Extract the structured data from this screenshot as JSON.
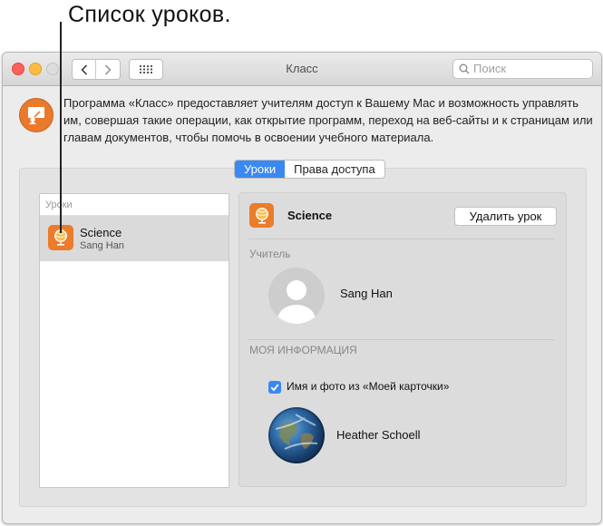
{
  "callout": {
    "text": "Список уроков."
  },
  "window": {
    "title": "Класс",
    "nav": {
      "back": "‹",
      "forward": "›"
    },
    "search_placeholder": "Поиск"
  },
  "description": "Программа «Класс» предоставляет учителям доступ к Вашему Mac и возможность управлять им, совершая такие операции, как открытие программ, переход на веб-сайты и к страницам или главам документов, чтобы помочь в освоении учебного материала.",
  "tabs": [
    {
      "label": "Уроки",
      "active": true
    },
    {
      "label": "Права доступа",
      "active": false
    }
  ],
  "lessons": {
    "header": "Уроки",
    "items": [
      {
        "name": "Science",
        "teacher": "Sang Han",
        "selected": true
      }
    ]
  },
  "details": {
    "title": "Science",
    "delete_label": "Удалить урок",
    "teacher_section": "Учитель",
    "teacher_name": "Sang Han",
    "my_info_section": "МОЯ ИНФОРМАЦИЯ",
    "checkbox_label": "Имя и фото из «Моей карточки»",
    "checkbox_checked": true,
    "student_name": "Heather Schoell"
  },
  "colors": {
    "accent": "#3b88f1",
    "lesson_icon": "#ea7c2c",
    "app_icon": "#e97a2d"
  }
}
